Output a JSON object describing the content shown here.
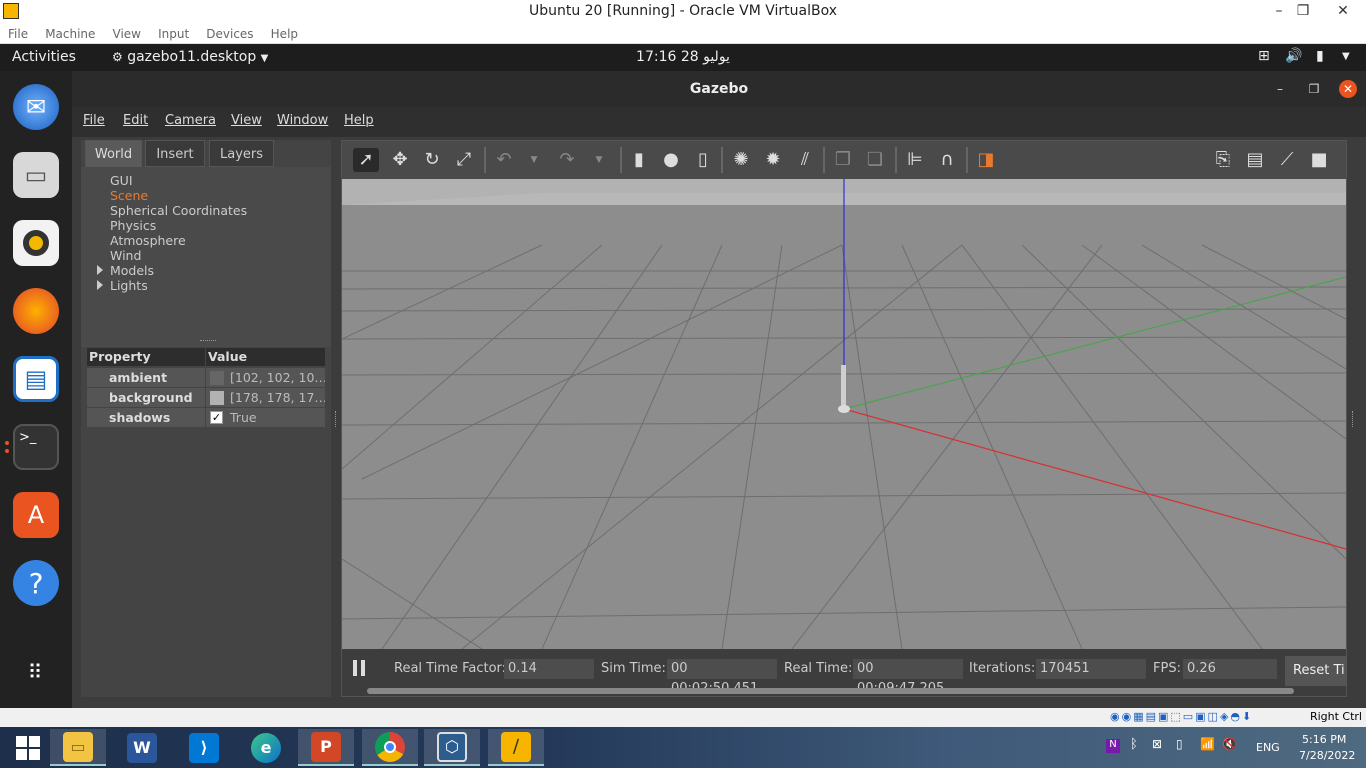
{
  "vbox": {
    "title": "Ubuntu 20 [Running] - Oracle VM VirtualBox",
    "menu": [
      "File",
      "Machine",
      "View",
      "Input",
      "Devices",
      "Help"
    ],
    "host_key": "Right Ctrl"
  },
  "ubuntu": {
    "activities": "Activities",
    "app_name": "gazebo11.desktop",
    "clock": "17:16  28 يوليو"
  },
  "gazebo": {
    "title": "Gazebo",
    "menu": [
      "File",
      "Edit",
      "Camera",
      "View",
      "Window",
      "Help"
    ],
    "tabs": [
      "World",
      "Insert",
      "Layers"
    ],
    "active_tab": "World",
    "tree": [
      {
        "label": "GUI",
        "expandable": false
      },
      {
        "label": "Scene",
        "expandable": false,
        "selected": true
      },
      {
        "label": "Spherical Coordinates",
        "expandable": false
      },
      {
        "label": "Physics",
        "expandable": false
      },
      {
        "label": "Atmosphere",
        "expandable": false
      },
      {
        "label": "Wind",
        "expandable": false
      },
      {
        "label": "Models",
        "expandable": true
      },
      {
        "label": "Lights",
        "expandable": true
      }
    ],
    "properties": {
      "header_property": "Property",
      "header_value": "Value",
      "rows": [
        {
          "name": "ambient",
          "value": "[102, 102, 10…",
          "swatch": "#666666"
        },
        {
          "name": "background",
          "value": "[178, 178, 17…",
          "swatch": "#b2b2b2"
        },
        {
          "name": "shadows",
          "value": "True",
          "checked": true
        }
      ]
    },
    "stats": {
      "real_time_factor_label": "Real Time Factor:",
      "real_time_factor": "0.14",
      "sim_time_label": "Sim Time:",
      "sim_time": "00 00:02:50.451",
      "real_time_label": "Real Time:",
      "real_time": "00 00:09:47.205",
      "iterations_label": "Iterations:",
      "iterations": "170451",
      "fps_label": "FPS:",
      "fps": "0.26",
      "reset_label": "Reset Ti"
    }
  },
  "taskbar": {
    "lang": "ENG",
    "time": "5:16 PM",
    "date": "7/28/2022"
  },
  "colors": {
    "accent_orange": "#e95420",
    "scene_gray": "#8c8c8c",
    "axis_x": "#d83030",
    "axis_y": "#3fa83f",
    "axis_z": "#3030d8"
  }
}
